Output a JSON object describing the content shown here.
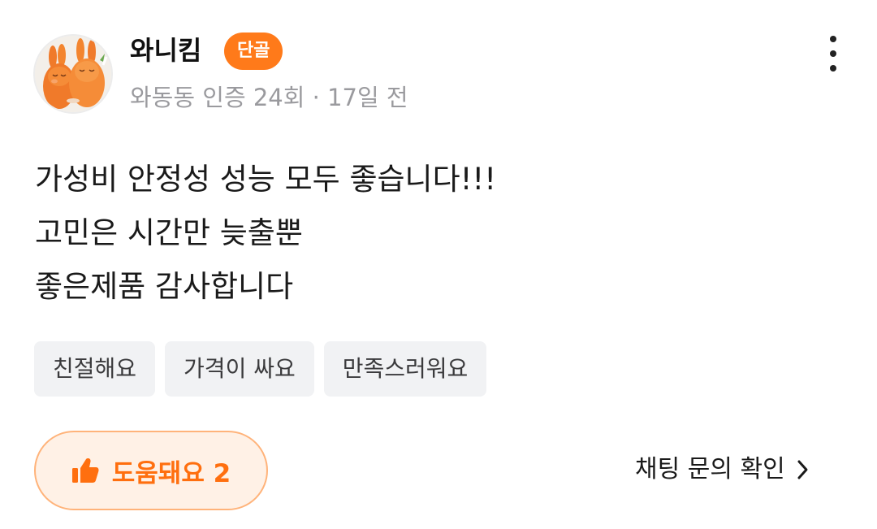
{
  "reviewer": {
    "name": "와니킴",
    "badge": "단골",
    "meta": "와동동 인증 24회 · 17일 전"
  },
  "review": {
    "lines": [
      "가성비 안정성 성능 모두 좋습니다!!!",
      "고민은 시간만 늦출뿐",
      "좋은제품 감사합니다"
    ]
  },
  "tags": [
    "친절해요",
    "가격이 싸요",
    "만족스러워요"
  ],
  "actions": {
    "helpful_label": "도움돼요 2",
    "chat_check_label": "채팅 문의 확인"
  },
  "icons": {
    "more": "more-vertical-icon",
    "thumbs_up": "thumbs-up-icon",
    "chevron": "chevron-right-icon"
  },
  "colors": {
    "accent": "#ff6f0f",
    "badge_bg": "#ff7a1a",
    "helpful_bg": "#fff1e6",
    "tag_bg": "#f1f2f4",
    "meta_text": "#9a9a9e"
  }
}
